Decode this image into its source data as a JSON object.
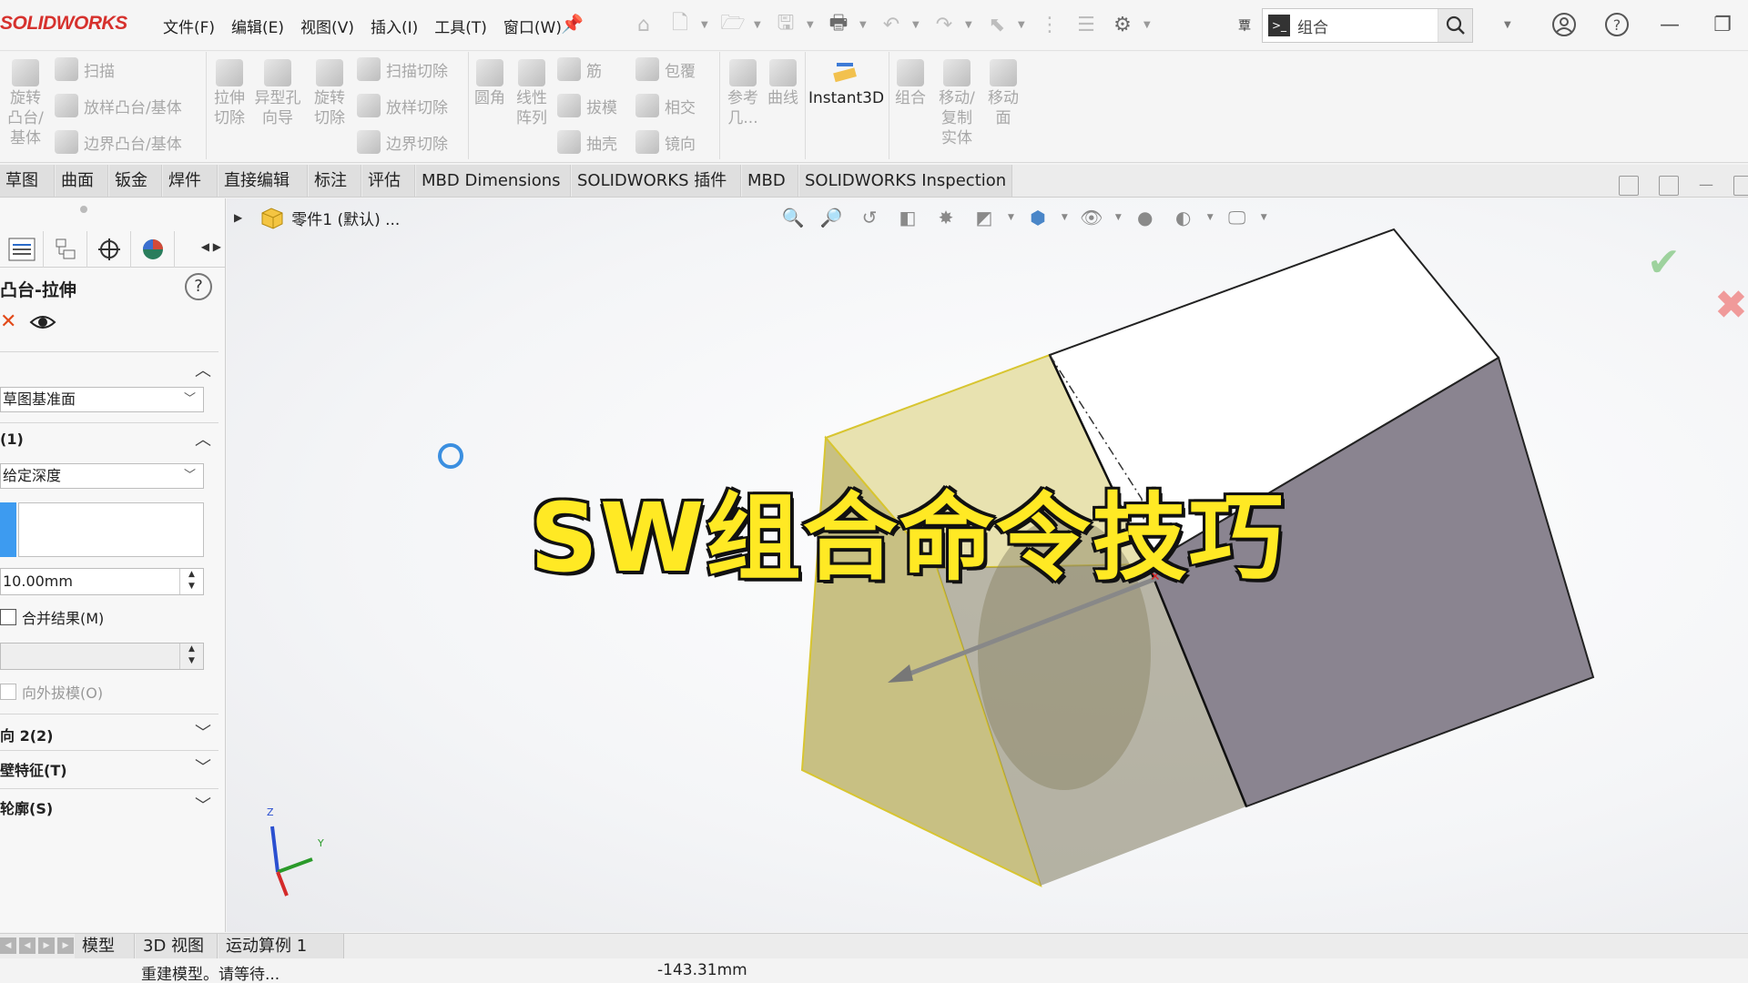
{
  "app": {
    "logo": "SOLIDWORKS"
  },
  "menu": [
    "文件(F)",
    "编辑(E)",
    "视图(V)",
    "插入(I)",
    "工具(T)",
    "窗口(W)"
  ],
  "search": {
    "value": "组合",
    "prefix": "覃"
  },
  "ribbon": {
    "revolve": "旋转\n凸台/\n基体",
    "sweep": "扫描",
    "loft": "放样凸台/基体",
    "boundary": "边界凸台/基体",
    "extrude_cut": "拉伸\n切除",
    "hole_wizard": "异型孔\n向导",
    "revolve_cut": "旋转\n切除",
    "sweep_cut": "扫描切除",
    "loft_cut": "放样切除",
    "boundary_cut": "边界切除",
    "fillet": "圆角",
    "linear_pattern": "线性\n阵列",
    "rib": "筋",
    "draft": "拔模",
    "shell": "抽壳",
    "wrap": "包覆",
    "intersect": "相交",
    "mirror": "镜向",
    "ref_geometry": "参考\n几...",
    "curves": "曲线",
    "instant3d": "Instant3D",
    "combine": "组合",
    "move_copy": "移动/\n复制\n实体",
    "move_face": "移动\n面"
  },
  "tabs": [
    "草图",
    "曲面",
    "钣金",
    "焊件",
    "直接编辑",
    "标注",
    "评估",
    "MBD Dimensions",
    "SOLIDWORKS 插件",
    "MBD",
    "SOLIDWORKS Inspection"
  ],
  "property_manager": {
    "title": "凸台-拉伸",
    "from_select": "草图基准面",
    "direction1_header": "(1)",
    "end_condition": "给定深度",
    "depth_value": "10.00mm",
    "merge_result": "合并结果(M)",
    "draft_outward": "向外拔模(O)",
    "direction2": "向 2(2)",
    "thin_feature": "壁特征(T)",
    "contours": "轮廓(S)"
  },
  "viewport": {
    "tree_root": "零件1 (默认) ...",
    "overlay_title": "SW组合命令技巧",
    "triad": {
      "z": "Z",
      "y": "Y"
    }
  },
  "bottom_tabs": [
    "模型",
    "3D 视图",
    "运动算例 1"
  ],
  "status": {
    "message": "重建模型。请等待...",
    "coordinate": "-143.31mm"
  },
  "colors": {
    "accent_blue": "#3d9bf0",
    "logo_red": "#d6312d",
    "title_yellow": "#ffe924",
    "ok_green": "#9ed29e",
    "cancel_red": "#f09a9a"
  }
}
